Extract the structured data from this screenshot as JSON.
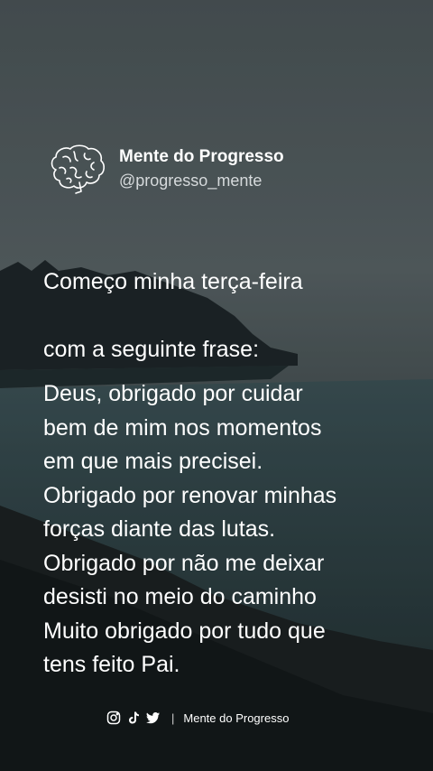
{
  "account": {
    "name": "Mente do Progresso",
    "handle": "@progresso_mente",
    "avatar_icon": "brain-icon"
  },
  "post": {
    "intro_lines": [
      "Começo minha terça-feira",
      "com a seguinte frase:"
    ],
    "body_lines": [
      "Deus, obrigado por cuidar",
      "bem de mim nos momentos",
      "em que mais precisei.",
      "Obrigado por renovar minhas",
      "forças diante das lutas.",
      "Obrigado por não me deixar",
      "desisti no meio do caminho",
      "Muito obrigado por tudo que",
      "tens feito Pai."
    ]
  },
  "footer": {
    "icons": [
      "instagram-icon",
      "tiktok-icon",
      "twitter-icon"
    ],
    "separator": "|",
    "brand": "Mente do Progresso"
  }
}
